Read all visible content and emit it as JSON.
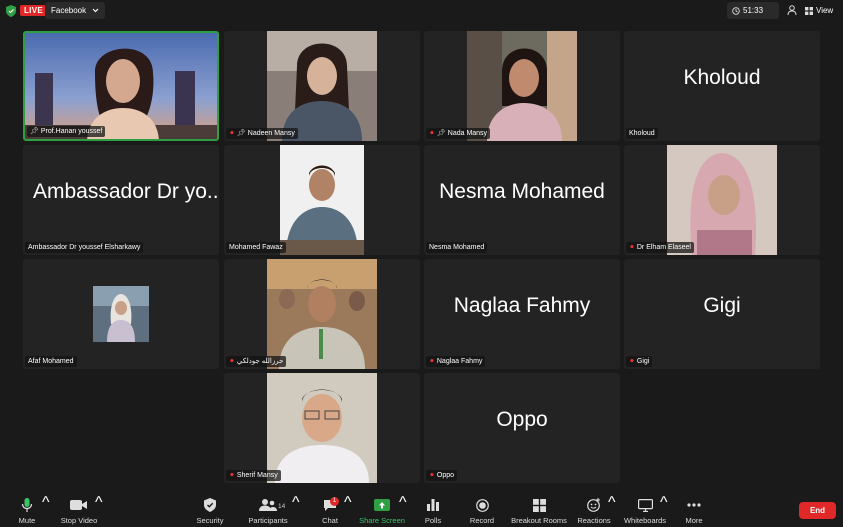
{
  "topbar": {
    "live_label": "LIVE",
    "stream_target": "Facebook",
    "timer": "51:33",
    "view_label": "View"
  },
  "participants": [
    {
      "name": "Prof.Hanan youssef",
      "muted": false,
      "pinned": true,
      "active": true,
      "display": "video"
    },
    {
      "name": "Nadeen Mansy",
      "muted": true,
      "pinned": true,
      "display": "video"
    },
    {
      "name": "Nada Mansy",
      "muted": true,
      "pinned": true,
      "display": "video"
    },
    {
      "name": "Kholoud",
      "muted": false,
      "display": "name",
      "big_name": "Kholoud"
    },
    {
      "name": "Ambassador Dr youssef Elsharkawy",
      "muted": false,
      "display": "name",
      "big_name": "Ambassador Dr yo..."
    },
    {
      "name": "Mohamed Fawaz",
      "muted": false,
      "display": "video"
    },
    {
      "name": "Nesma Mohamed",
      "muted": false,
      "display": "name",
      "big_name": "Nesma Mohamed"
    },
    {
      "name": "Dr Elham Elaseel",
      "muted": true,
      "display": "video"
    },
    {
      "name": "Afaf Mohamed",
      "muted": false,
      "display": "video"
    },
    {
      "name": "حرزالله جودلكي",
      "muted": true,
      "display": "video"
    },
    {
      "name": "Naglaa Fahmy",
      "muted": true,
      "display": "name",
      "big_name": "Naglaa Fahmy"
    },
    {
      "name": "Gigi",
      "muted": true,
      "display": "name",
      "big_name": "Gigi"
    },
    {
      "name": "Sherif Mansy",
      "muted": true,
      "display": "video"
    },
    {
      "name": "Oppo",
      "muted": true,
      "display": "name",
      "big_name": "Oppo"
    }
  ],
  "toolbar": {
    "mute": "Mute",
    "stop_video": "Stop Video",
    "security": "Security",
    "participants": "Participants",
    "participants_count": "14",
    "chat": "Chat",
    "chat_badge": "1",
    "share_screen": "Share Screen",
    "polls": "Polls",
    "record": "Record",
    "breakout": "Breakout Rooms",
    "reactions": "Reactions",
    "whiteboards": "Whiteboards",
    "more": "More",
    "end": "End"
  },
  "colors": {
    "accent_green": "#2ea043",
    "live_red": "#e02828",
    "background": "#1a1a1a",
    "tile": "#232323"
  },
  "icons": [
    "shield-icon",
    "chevron-down-icon",
    "clock-icon",
    "person-icon",
    "grid-icon",
    "mic-icon",
    "video-icon",
    "security-shield-icon",
    "participants-icon",
    "chat-icon",
    "share-screen-icon",
    "polls-icon",
    "record-icon",
    "breakout-icon",
    "reactions-icon",
    "whiteboard-icon",
    "more-icon",
    "mic-off-icon",
    "pin-icon"
  ]
}
